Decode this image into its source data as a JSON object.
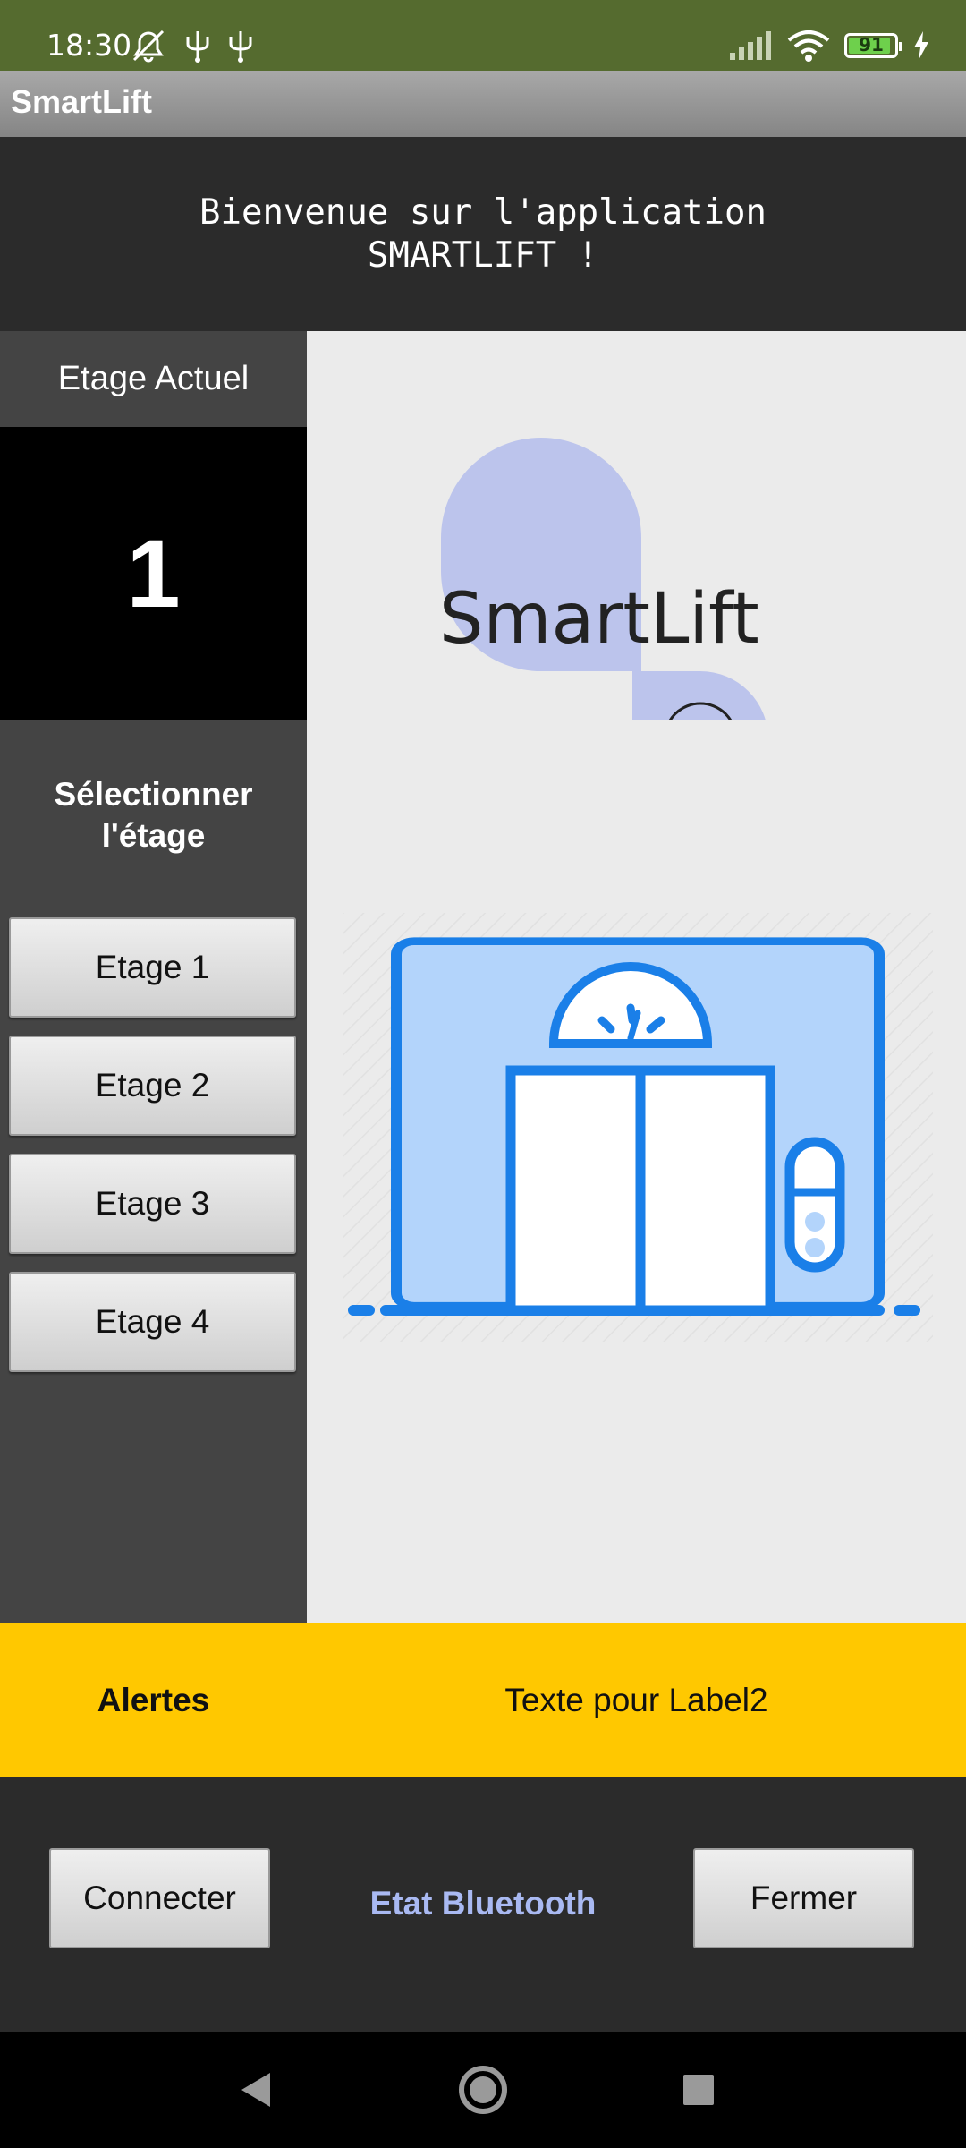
{
  "status_bar": {
    "time": "18:30",
    "battery": "91",
    "battery_level": 0.91,
    "icons": [
      "mute-icon",
      "usb-icon",
      "usb-icon",
      "signal-icon",
      "wifi-icon",
      "battery-icon",
      "charging-icon"
    ]
  },
  "app": {
    "title": "SmartLift"
  },
  "welcome": {
    "line1": "Bienvenue sur l'application",
    "line2": "SMARTLIFT !"
  },
  "floor_panel": {
    "current_label": "Etage Actuel",
    "current_value": "1",
    "select_line1": "Sélectionner",
    "select_line2": "l'étage",
    "buttons": [
      "Etage 1",
      "Etage 2",
      "Etage 3",
      "Etage 4"
    ]
  },
  "logo": {
    "text": "SmartLift"
  },
  "alerts": {
    "label": "Alertes",
    "text": "Texte pour Label2"
  },
  "controls": {
    "connect": "Connecter",
    "bluetooth_status": "Etat Bluetooth",
    "close": "Fermer"
  },
  "colors": {
    "status_bar": "#556b2f",
    "accent_yellow": "#ffc800",
    "bluetooth_text": "#a9b9f2",
    "logo_blob": "#bcc4ec",
    "elevator_blue": "#1a7fe8",
    "elevator_light": "#b3d4fb"
  }
}
